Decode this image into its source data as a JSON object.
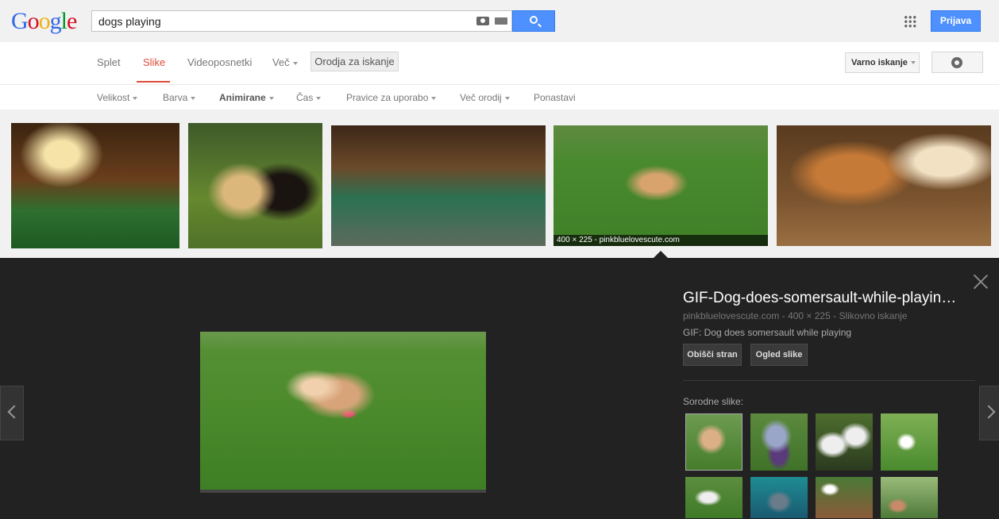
{
  "header": {
    "logo_letters": [
      {
        "ch": "G",
        "cls": "b"
      },
      {
        "ch": "o",
        "cls": "r"
      },
      {
        "ch": "o",
        "cls": "y"
      },
      {
        "ch": "g",
        "cls": "b"
      },
      {
        "ch": "l",
        "cls": "g"
      },
      {
        "ch": "e",
        "cls": "r"
      }
    ],
    "search_value": "dogs playing",
    "signin_label": "Prijava"
  },
  "tabs": {
    "items": [
      "Splet",
      "Slike",
      "Videoposnetki",
      "Več"
    ],
    "active": "Slike",
    "tools_label": "Orodja za iskanje",
    "safe_search_label": "Varno iskanje"
  },
  "toolbar": {
    "items": [
      "Velikost",
      "Barva",
      "Animirane",
      "Čas",
      "Pravice za uporabo",
      "Več orodij",
      "Ponastavi"
    ],
    "bold": "Animirane"
  },
  "results": {
    "selected_caption": "400 × 225 - pinkbluelovescute.com"
  },
  "preview": {
    "title": "GIF-Dog-does-somersault-while-playin…",
    "meta": "pinkbluelovescute.com - 400 × 225 - Slikovno iskanje",
    "description": "GIF: Dog does somersault while playing",
    "visit_label": "Obišči stran",
    "view_label": "Ogled slike",
    "related_label": "Sorodne slike:"
  },
  "colors": {
    "accent_blue": "#4d90fe",
    "active_tab": "#dd4b39",
    "panel_bg": "#222222"
  }
}
